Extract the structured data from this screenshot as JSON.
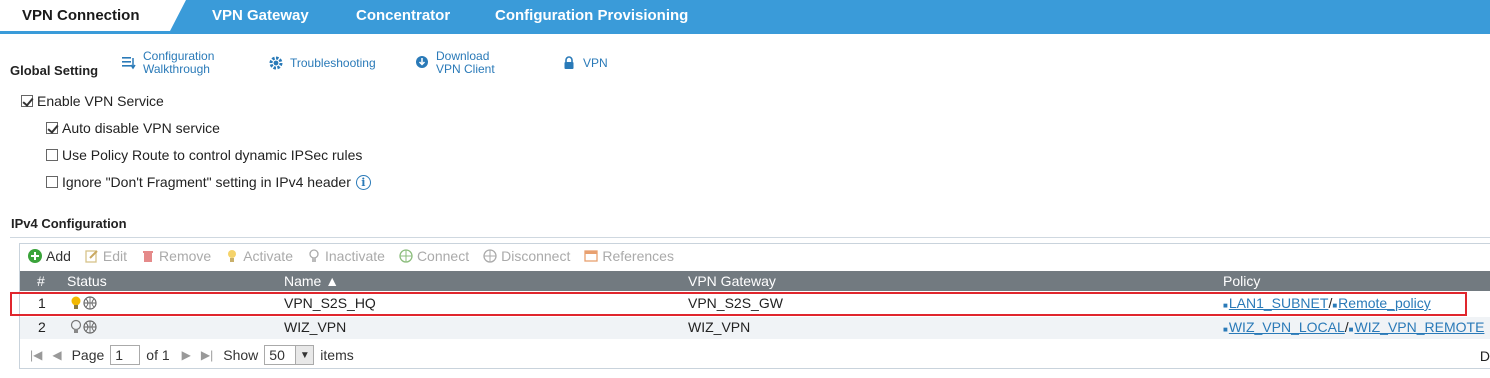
{
  "tabs": [
    {
      "label": "VPN Connection",
      "active": true
    },
    {
      "label": "VPN Gateway"
    },
    {
      "label": "Concentrator"
    },
    {
      "label": "Configuration Provisioning"
    }
  ],
  "global_setting": {
    "title": "Global Setting",
    "links": {
      "config_walkthrough": [
        "Configuration",
        "Walkthrough"
      ],
      "troubleshooting": "Troubleshooting",
      "download_client": [
        "Download",
        "VPN Client"
      ],
      "vpn": "VPN"
    },
    "options": {
      "enable_vpn": {
        "label": "Enable VPN Service",
        "checked": true
      },
      "auto_disable": {
        "label": "Auto disable VPN service",
        "checked": true
      },
      "policy_route": {
        "label": "Use Policy Route to control dynamic IPSec rules",
        "checked": false
      },
      "ignore_df": {
        "label": "Ignore \"Don't Fragment\" setting in IPv4 header",
        "checked": false
      }
    }
  },
  "ipv4": {
    "title": "IPv4 Configuration",
    "toolbar": {
      "add": "Add",
      "edit": "Edit",
      "remove": "Remove",
      "activate": "Activate",
      "inactivate": "Inactivate",
      "connect": "Connect",
      "disconnect": "Disconnect",
      "references": "References"
    },
    "columns": {
      "num": "#",
      "status": "Status",
      "name": "Name ▲",
      "gateway": "VPN Gateway",
      "policy": "Policy"
    },
    "rows": [
      {
        "num": "1",
        "name": "VPN_S2S_HQ",
        "gateway": "VPN_S2S_GW",
        "local": "LAN1_SUBNET",
        "sep": "/",
        "remote": "Remote_policy",
        "selected": true
      },
      {
        "num": "2",
        "name": "WIZ_VPN",
        "gateway": "WIZ_VPN",
        "local": "WIZ_VPN_LOCAL",
        "sep": "/",
        "remote": "WIZ_VPN_REMOTE",
        "selected": false
      }
    ],
    "pager": {
      "page_label": "Page",
      "page": "1",
      "of_label": "of 1",
      "show_label": "Show",
      "show_value": "50",
      "items_label": "items",
      "trailing": "D"
    }
  },
  "colors": {
    "tabbar": "#3a9bd9",
    "highlight": "#e0262d",
    "link": "#2a7ab8",
    "header": "#727a80"
  }
}
